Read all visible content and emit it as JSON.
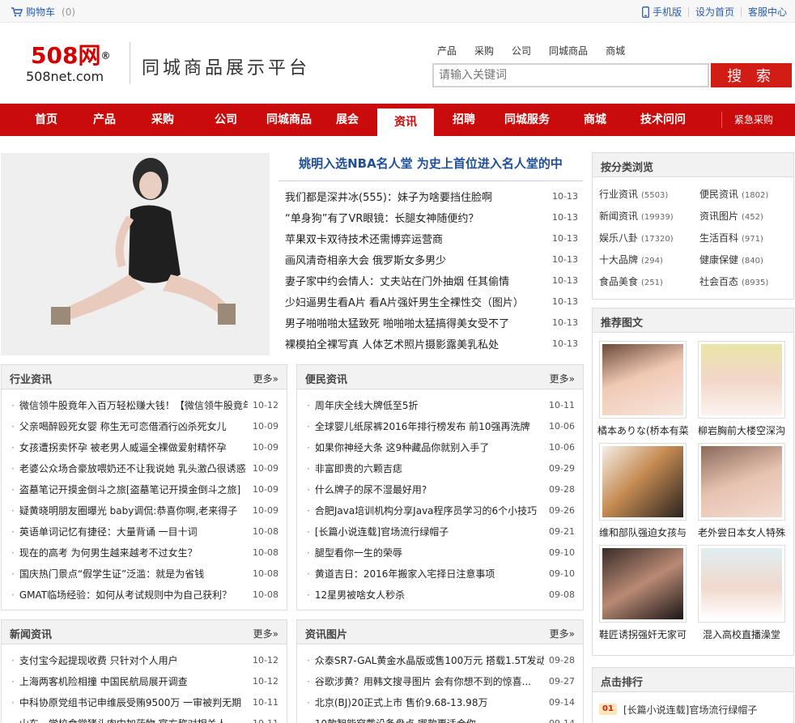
{
  "topbar": {
    "cart_label": "购物车",
    "cart_count": "(0)",
    "links": [
      "手机版",
      "设为首页",
      "客服中心"
    ]
  },
  "header": {
    "logo_cn": "508网",
    "logo_mark": "®",
    "logo_en": "508net.com",
    "slogan": "同城商品展示平台",
    "search_categories": [
      "产品",
      "采购",
      "公司",
      "同城商品",
      "商城"
    ],
    "search_placeholder": "请输入关键词",
    "search_button": "搜 索"
  },
  "nav": {
    "items": [
      "首页",
      "产品",
      "采购",
      "公司",
      "同城商品",
      "展会",
      "资讯",
      "招聘",
      "同城服务",
      "商城",
      "技术问问"
    ],
    "active": "资讯",
    "urgent": "紧急采购"
  },
  "hero": {
    "headline": "姚明入选NBA名人堂 为史上首位进入名人堂的中",
    "items": [
      {
        "title": "我们都是深井冰(555)：妹子为啥要挡住脸啊",
        "date": "10-13"
      },
      {
        "title": "“单身狗”有了VR眼镜：长腿女神随便约？",
        "date": "10-13"
      },
      {
        "title": "苹果双卡双待技术还需博弈运营商",
        "date": "10-13"
      },
      {
        "title": "画风清奇相亲大会 俄罗斯女多男少",
        "date": "10-13"
      },
      {
        "title": "妻子家中约会情人：丈夫站在门外抽烟 任其偷情",
        "date": "10-13"
      },
      {
        "title": "少妇逼男生看A片 看A片强奸男生全裸性交（图片）",
        "date": "10-13"
      },
      {
        "title": "男子啪啪啪太猛致死 啪啪啪太猛搞得美女受不了",
        "date": "10-13"
      },
      {
        "title": "裸模拍全裸写真 人体艺术照片摄影露美乳私处",
        "date": "10-13"
      }
    ]
  },
  "more_label": "更多»",
  "panels": {
    "industry": {
      "title": "行业资讯",
      "items": [
        {
          "title": "微信领牛股竟年入百万轻松赚大钱！【微信领牛股竟年",
          "date": "10-12"
        },
        {
          "title": "父亲喝醉殴死女婴 称生无可恋借酒行凶杀死女儿",
          "date": "10-09"
        },
        {
          "title": "女孩遭拐卖怀孕 被老男人威逼全裸做爱射精怀孕",
          "date": "10-09"
        },
        {
          "title": "老婆公众场合豪放喂奶还不让我说她 乳头激凸很诱惑",
          "date": "10-09"
        },
        {
          "title": "盗墓笔记开摸金倒斗之旅[盗墓笔记开摸金倒斗之旅]",
          "date": "10-09"
        },
        {
          "title": "疑黄晓明朋友圈曝光 baby调侃:恭喜你啊,老来得子",
          "date": "10-09"
        },
        {
          "title": "英语单词记忆有捷径：大量背诵 一目十词",
          "date": "10-08"
        },
        {
          "title": "现在的高考 为何男生越来越考不过女生？",
          "date": "10-08"
        },
        {
          "title": "国庆热门景点“假学生证”泛滥：就是为省钱",
          "date": "10-08"
        },
        {
          "title": "GMAT临场经验：如何从考试规则中为自己获利？",
          "date": "10-08"
        }
      ]
    },
    "public": {
      "title": "便民资讯",
      "items": [
        {
          "title": "周年庆全线大牌低至5折",
          "date": "10-11"
        },
        {
          "title": "全球婴儿纸尿裤2016年排行榜发布 前10强再洗牌",
          "date": "10-06"
        },
        {
          "title": "如果你神经大条 这9种藏品你就别入手了",
          "date": "10-06"
        },
        {
          "title": "非富即贵的六颗吉痣",
          "date": "09-29"
        },
        {
          "title": "什么牌子的尿不湿最好用?",
          "date": "09-28"
        },
        {
          "title": "合肥Java培训机构分享Java程序员学习的6个小技巧",
          "date": "09-26"
        },
        {
          "title": "[长篇小说连载]官场流行绿帽子",
          "date": "09-21"
        },
        {
          "title": "腿型看你一生的荣辱",
          "date": "09-10"
        },
        {
          "title": "黄道吉日：2016年搬家入宅择日注意事项",
          "date": "09-10"
        },
        {
          "title": "12星男被啥女人秒杀",
          "date": "09-08"
        }
      ]
    },
    "news": {
      "title": "新闻资讯",
      "items": [
        {
          "title": "支付宝今起提现收费 只针对个人用户",
          "date": "10-12"
        },
        {
          "title": "上海两客机险相撞 中国民航局展开调查",
          "date": "10-12"
        },
        {
          "title": "中科协原党组书记申维辰受贿9500万 一审被判无期",
          "date": "10-11"
        },
        {
          "title": "山东一学校食堂猪头肉中加药物 官方称对相关人",
          "date": "10-11"
        }
      ]
    },
    "photo": {
      "title": "资讯图片",
      "items": [
        {
          "title": "众泰SR7-GAL黄金水晶版或售100万元 搭载1.5T发动",
          "date": "09-28"
        },
        {
          "title": "谷歌涉黄？用韩文搜寻图片 会有你想不到的惊喜...",
          "date": "09-27"
        },
        {
          "title": "北京(BJ)20正式上市 售价9.68-13.98万",
          "date": "09-14"
        },
        {
          "title": "10款智能穿戴设备盘点 哪款更适合你",
          "date": "09-14"
        }
      ]
    }
  },
  "sidebar": {
    "categories_title": "按分类浏览",
    "categories": [
      {
        "name": "行业资讯",
        "count": "(5503)"
      },
      {
        "name": "便民资讯",
        "count": "(1802)"
      },
      {
        "name": "新闻资讯",
        "count": "(19939)"
      },
      {
        "name": "资讯图片",
        "count": "(452)"
      },
      {
        "name": "娱乐八卦",
        "count": "(17320)"
      },
      {
        "name": "生活百科",
        "count": "(971)"
      },
      {
        "name": "十大品牌",
        "count": "(294)"
      },
      {
        "name": "健康保健",
        "count": "(840)"
      },
      {
        "name": "食品美食",
        "count": "(251)"
      },
      {
        "name": "社会百态",
        "count": "(8935)"
      }
    ],
    "pics_title": "推荐图文",
    "pics": [
      "橘本ありな(桥本有菜)",
      "柳岩胸前大楼空深沟",
      "维和部队强迫女孩与",
      "老外尝日本女人特殊",
      "鞋匠诱拐强奸无家可",
      "混入高校直播澡堂"
    ],
    "rank_title": "点击排行",
    "rank": [
      {
        "num": "01",
        "title": "[长篇小说连载]官场流行绿帽子"
      }
    ]
  },
  "colors": {
    "nav_red": "#c90b0b",
    "link_blue": "#1f4f98"
  }
}
